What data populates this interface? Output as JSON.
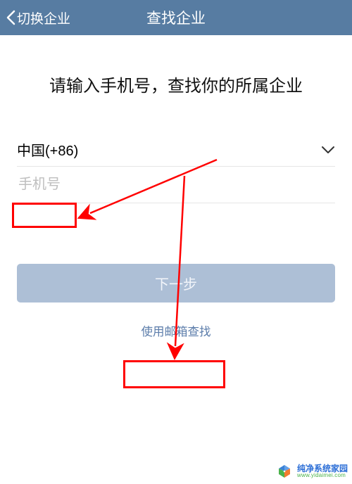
{
  "header": {
    "back_label": "切换企业",
    "title": "查找企业"
  },
  "main": {
    "prompt": "请输入手机号，查找你的所属企业",
    "country": {
      "label": "中国(+86)"
    },
    "phone": {
      "placeholder": "手机号",
      "value": ""
    },
    "next_label": "下一步",
    "email_link_label": "使用邮箱查找"
  },
  "annotations": {
    "highlight_phone": true,
    "highlight_email": true
  },
  "watermark": {
    "brand": "纯净系统家园",
    "url": "www.yidaimei.com"
  }
}
